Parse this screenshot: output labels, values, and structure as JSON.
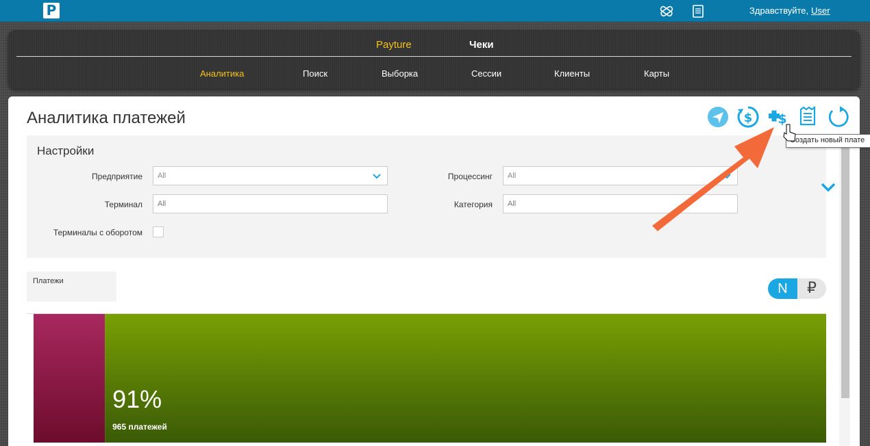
{
  "topbar": {
    "logo_letter": "P",
    "greeting": "Здравствуйте,",
    "user": "User"
  },
  "nav": {
    "primary": [
      {
        "label": "Payture",
        "active": true
      },
      {
        "label": "Чеки",
        "active": false
      }
    ],
    "secondary": [
      {
        "label": "Аналитика",
        "active": true
      },
      {
        "label": "Поиск",
        "active": false
      },
      {
        "label": "Выборка",
        "active": false
      },
      {
        "label": "Сессии",
        "active": false
      },
      {
        "label": "Клиенты",
        "active": false
      },
      {
        "label": "Карты",
        "active": false
      }
    ]
  },
  "page": {
    "title": "Аналитика платежей",
    "tooltip": "Создать новый плате"
  },
  "settings": {
    "title": "Настройки",
    "enterprise_label": "Предприятие",
    "enterprise_value": "All",
    "processing_label": "Процессинг",
    "processing_value": "All",
    "terminal_label": "Терминал",
    "terminal_placeholder": "All",
    "category_label": "Категория",
    "category_placeholder": "All",
    "turnover_label": "Терминалы с оборотом"
  },
  "payments": {
    "label": "Платежи",
    "toggle_n": "N",
    "toggle_rub": "₽"
  },
  "chart_data": {
    "type": "bar",
    "segments": [
      {
        "name": "",
        "share": 0.09,
        "color_top": "#a8285f",
        "color_bottom": "#6d0c2c"
      },
      {
        "name": "",
        "share": 0.91,
        "color_top": "#78a004",
        "color_bottom": "#3b5a06"
      }
    ],
    "percent_label": "91%",
    "count_label": "965 платежей"
  },
  "colors": {
    "brand": "#0a7aab",
    "accent": "#f6c31b",
    "icon_blue": "#1aa7e2",
    "arrow": "#f26a3a"
  }
}
